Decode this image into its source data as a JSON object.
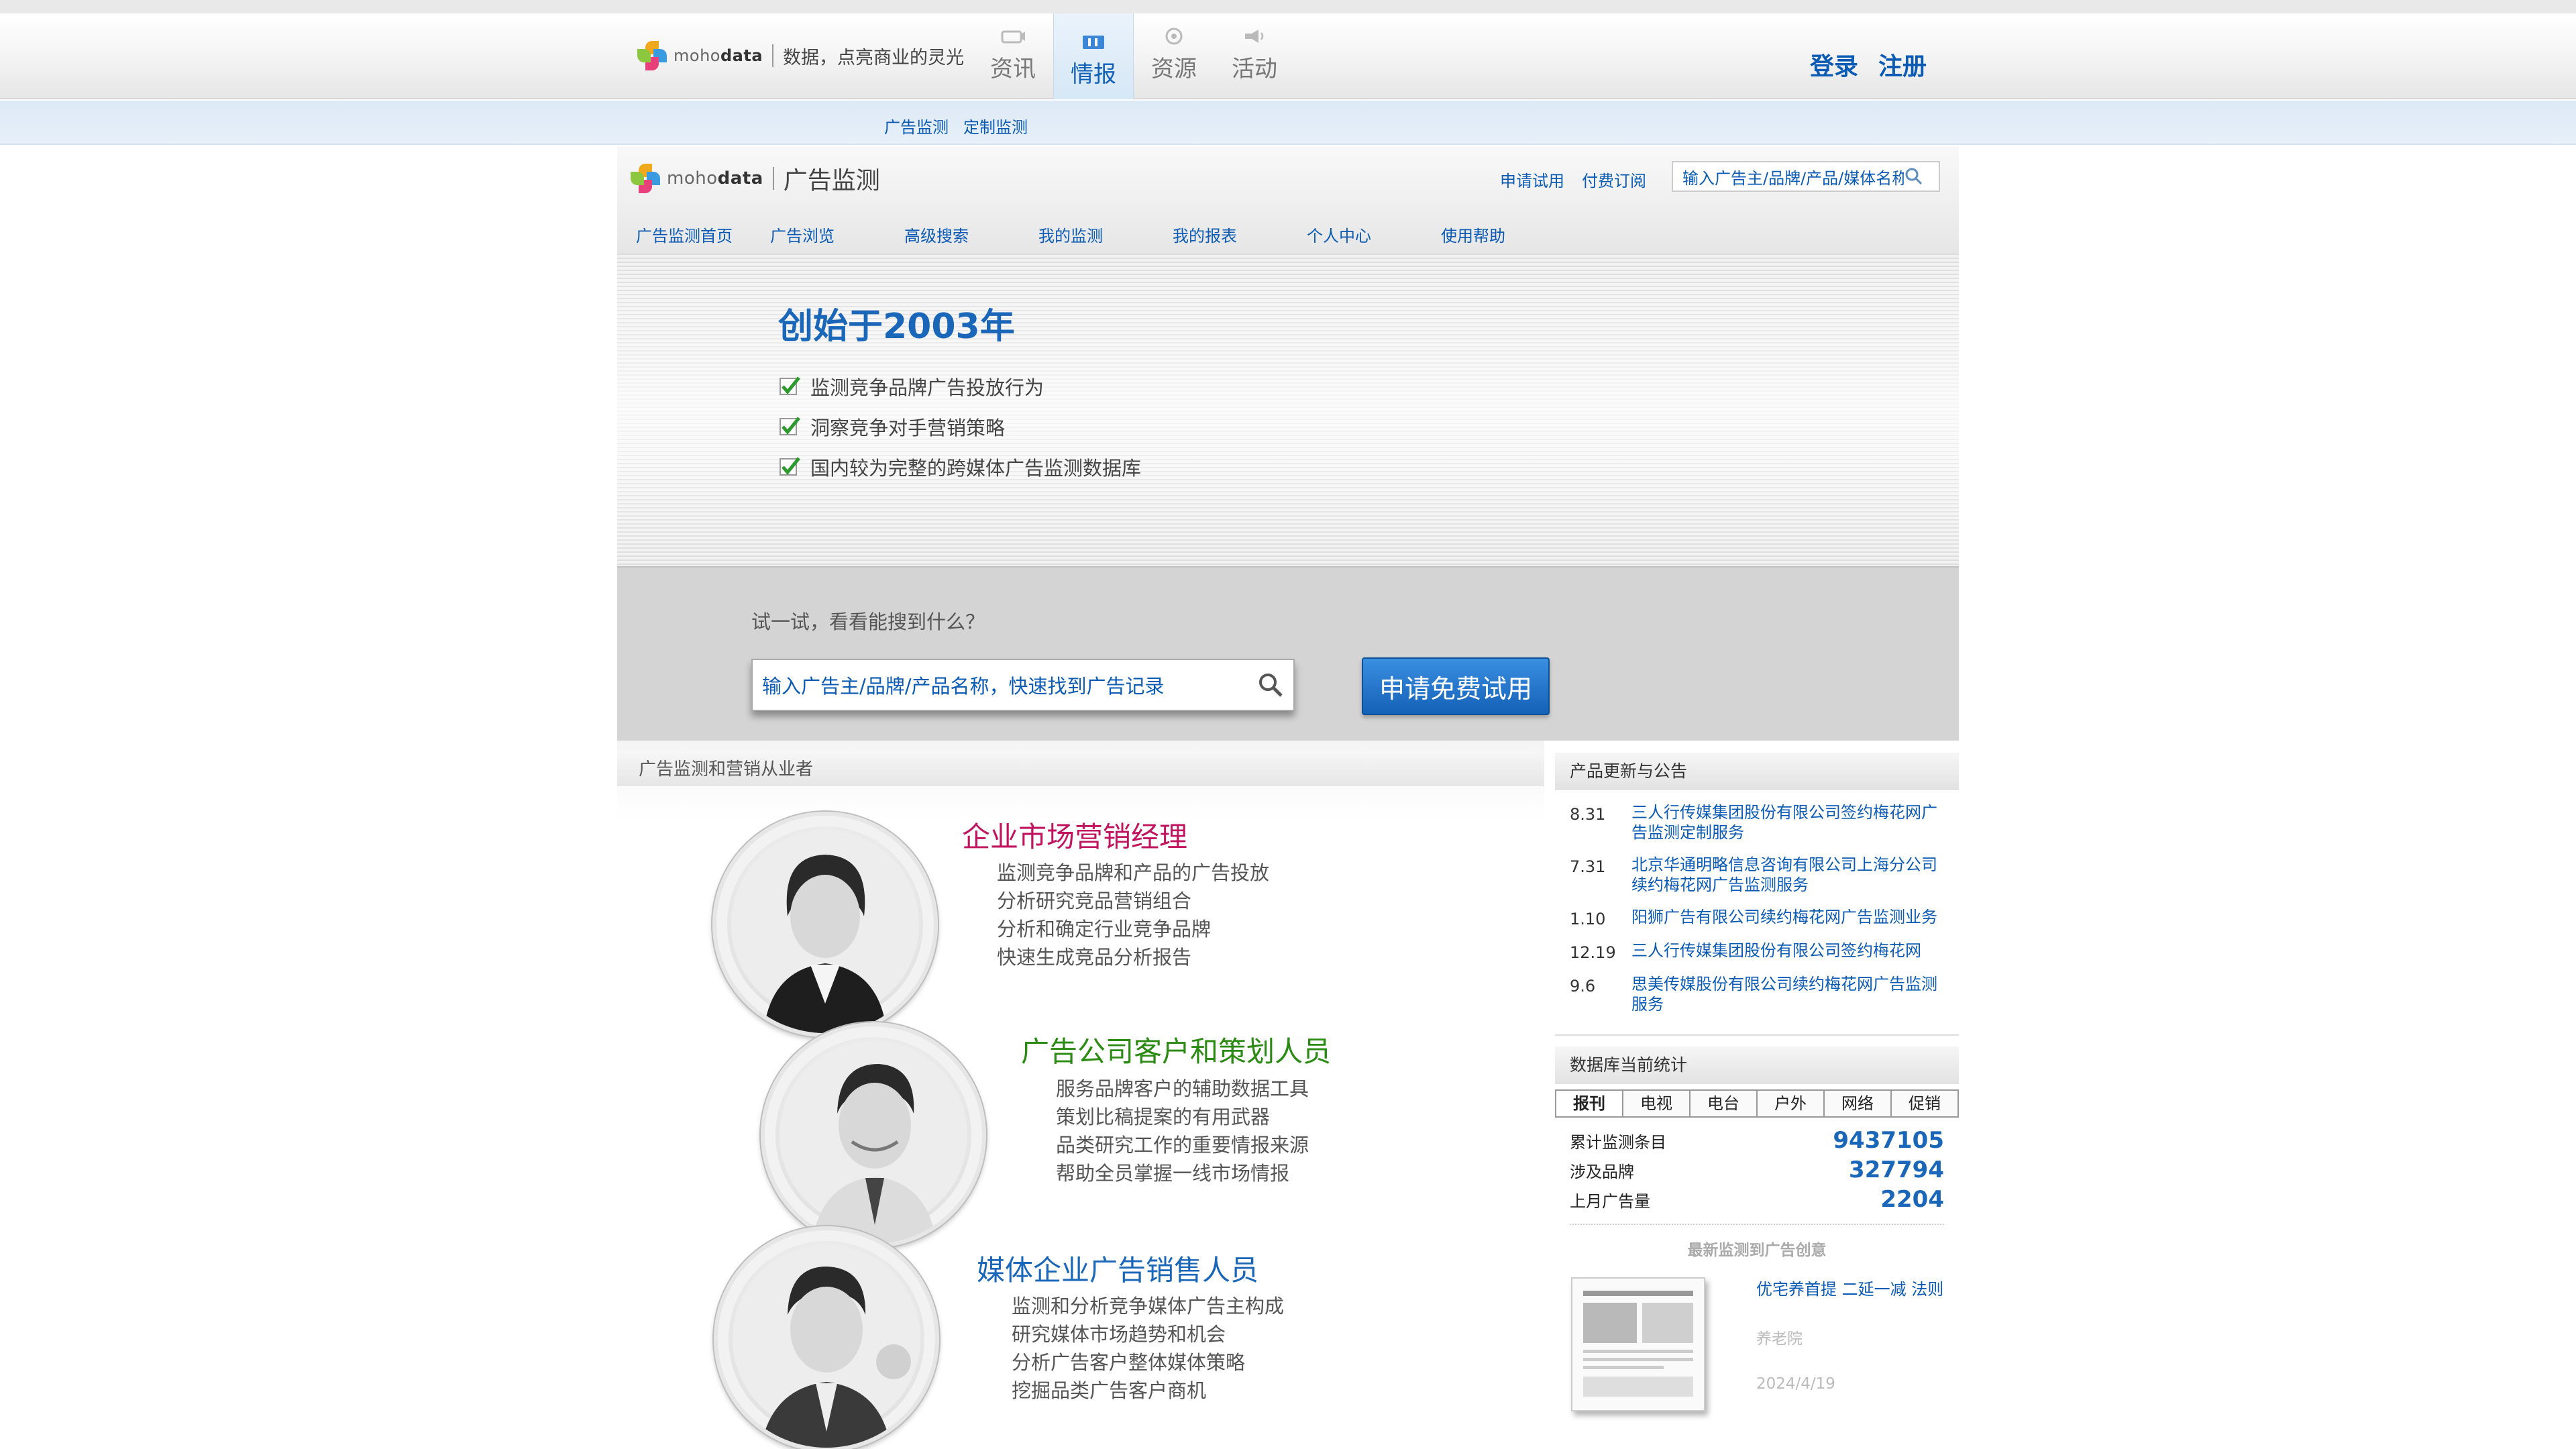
{
  "header": {
    "logo_text_a": "moho",
    "logo_text_b": "data",
    "slogan": "数据，点亮商业的灵光",
    "nav": [
      {
        "label": "资讯",
        "icon": "news-icon"
      },
      {
        "label": "情报",
        "icon": "intel-icon"
      },
      {
        "label": "资源",
        "icon": "resource-icon"
      },
      {
        "label": "活动",
        "icon": "event-icon"
      }
    ],
    "login": "登录",
    "register": "注册"
  },
  "subnav": {
    "links": [
      "广告监测",
      "定制监测"
    ]
  },
  "product": {
    "logo_text_a": "moho",
    "logo_text_b": "data",
    "title": "广告监测",
    "links": [
      "申请试用",
      "付费订阅"
    ],
    "search_placeholder": "输入广告主/品牌/产品/媒体名称",
    "menu": [
      "广告监测首页",
      "广告浏览",
      "高级搜索",
      "我的监测",
      "我的报表",
      "个人中心",
      "使用帮助"
    ]
  },
  "hero": {
    "title": "创始于2003年",
    "bullets": [
      "监测竞争品牌广告投放行为",
      "洞察竞争对手营销策略",
      "国内较为完整的跨媒体广告监测数据库"
    ]
  },
  "try": {
    "label": "试一试，看看能搜到什么？",
    "input_text": "输入广告主/品牌/产品名称，快速找到广告记录",
    "button": "申请免费试用"
  },
  "roles": {
    "heading": "广告监测和营销从业者",
    "items": [
      {
        "title": "企业市场营销经理",
        "color": "#c0145f",
        "lines": [
          "监测竞争品牌和产品的广告投放",
          "分析研究竞品营销组合",
          "分析和确定行业竞争品牌",
          "快速生成竞品分析报告"
        ]
      },
      {
        "title": "广告公司客户和策划人员",
        "color": "#2a8a12",
        "lines": [
          "服务品牌客户的辅助数据工具",
          "策划比稿提案的有用武器",
          "品类研究工作的重要情报来源",
          "帮助全员掌握一线市场情报"
        ]
      },
      {
        "title": "媒体企业广告销售人员",
        "color": "#1a66b8",
        "lines": [
          "监测和分析竞争媒体广告主构成",
          "研究媒体市场趋势和机会",
          "分析广告客户整体媒体策略",
          "挖掘品类广告客户商机"
        ]
      }
    ]
  },
  "news": {
    "heading": "产品更新与公告",
    "items": [
      {
        "date": "8.31",
        "title": "三人行传媒集团股份有限公司签约梅花网广告监测定制服务"
      },
      {
        "date": "7.31",
        "title": "北京华通明略信息咨询有限公司上海分公司续约梅花网广告监测服务"
      },
      {
        "date": "1.10",
        "title": "阳狮广告有限公司续约梅花网广告监测业务"
      },
      {
        "date": "12.19",
        "title": "三人行传媒集团股份有限公司签约梅花网"
      },
      {
        "date": "9.6",
        "title": "思美传媒股份有限公司续约梅花网广告监测服务"
      }
    ]
  },
  "stats": {
    "heading": "数据库当前统计",
    "tabs": [
      "报刊",
      "电视",
      "电台",
      "户外",
      "网络",
      "促销"
    ],
    "rows": [
      {
        "label": "累计监测条目",
        "value": "9437105"
      },
      {
        "label": "涉及品牌",
        "value": "327794"
      },
      {
        "label": "上月广告量",
        "value": "2204"
      }
    ],
    "latest_heading": "最新监测到广告创意",
    "latest_title": "优宅养首提 二延一减 法则",
    "latest_sub": "养老院",
    "latest_date": "2024/4/19"
  },
  "colors": {
    "brand_blue": "#0b5bb5",
    "accent_blue": "#1a66b8"
  }
}
